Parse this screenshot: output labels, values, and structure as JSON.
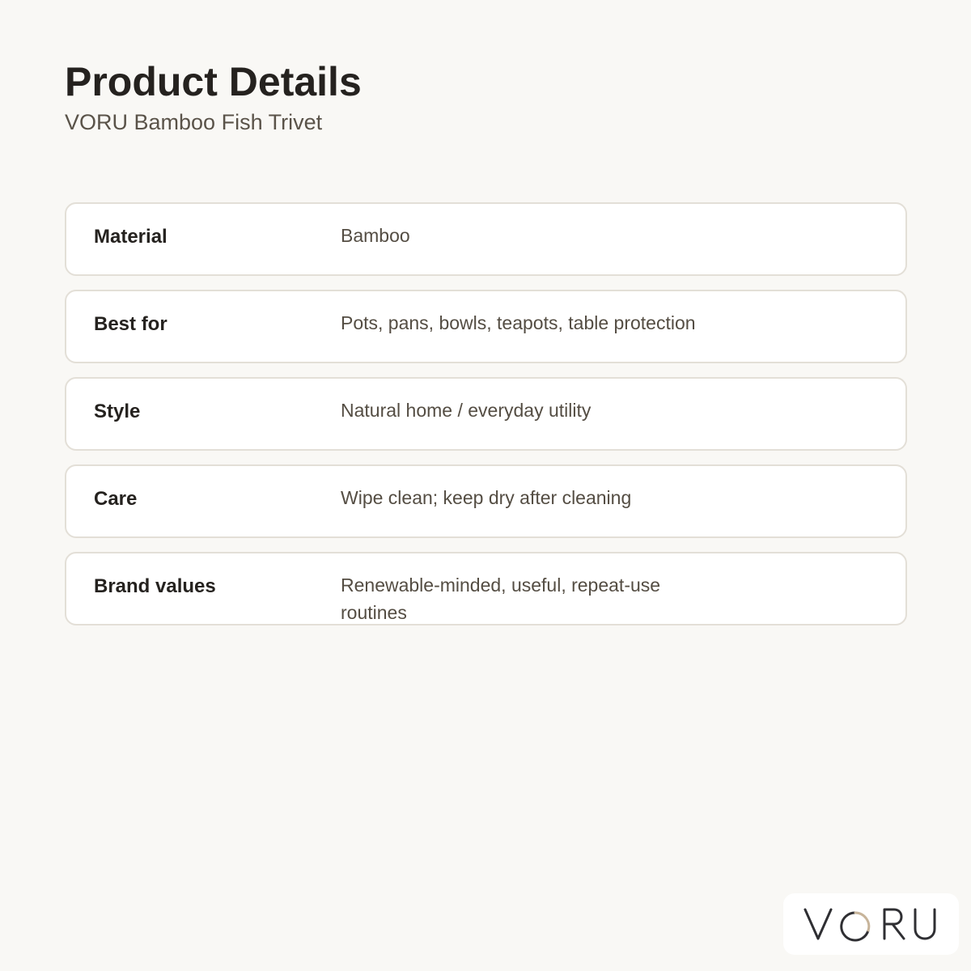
{
  "header": {
    "title": "Product Details",
    "subtitle": "VORU Bamboo Fish Trivet"
  },
  "details": [
    {
      "label": "Material",
      "value": "Bamboo"
    },
    {
      "label": "Best for",
      "value": "Pots, pans, bowls, teapots, table protection"
    },
    {
      "label": "Style",
      "value": "Natural home / everyday utility"
    },
    {
      "label": "Care",
      "value": "Wipe clean; keep dry after cleaning"
    },
    {
      "label": "Brand values",
      "value": "Renewable-minded, useful, repeat-use routines"
    }
  ],
  "brand": {
    "logo_text": "VORU",
    "logo_color": "#2f2f33",
    "logo_accent": "#c7b49a"
  },
  "colors": {
    "background": "#f9f8f5",
    "card_border": "#e3dfd7",
    "heading": "#25221f",
    "body_text": "#544d43"
  }
}
